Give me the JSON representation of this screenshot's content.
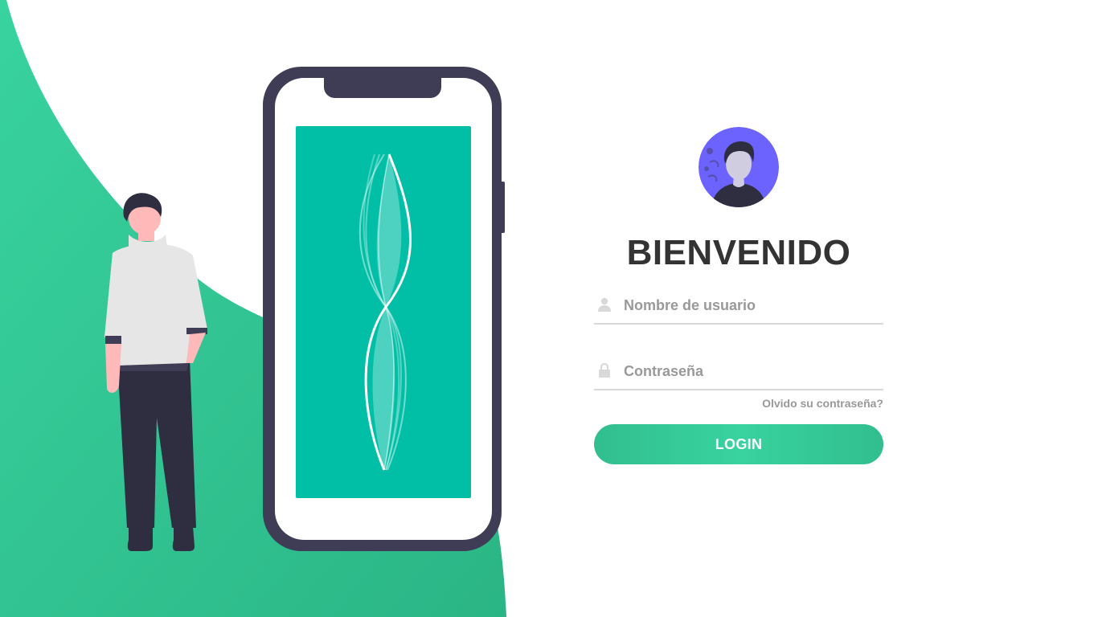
{
  "login": {
    "title": "BIENVENIDO",
    "username_placeholder": "Nombre de usuario",
    "password_placeholder": "Contraseña",
    "forgot_link": "Olvido su contraseña?",
    "login_button": "LOGIN"
  },
  "icons": {
    "username": "user-icon",
    "password": "lock-icon",
    "avatar": "avatar-icon"
  },
  "colors": {
    "accent": "#38d39f",
    "accent_dark": "#32be8f",
    "phone_screen": "#00bfa6",
    "phone_frame": "#3f3d56",
    "avatar_bg": "#6c63ff",
    "text_dark": "#333333",
    "text_muted": "#999999"
  }
}
